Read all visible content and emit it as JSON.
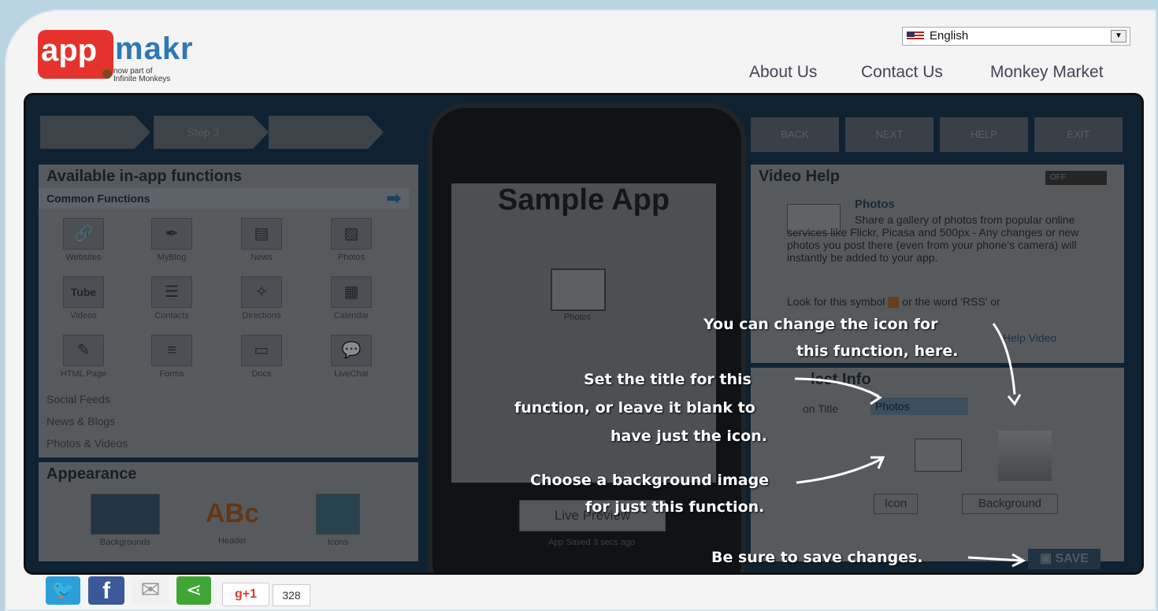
{
  "header": {
    "logo_app": "app",
    "logo_makr": "makr",
    "logo_sub_line1": "now part of",
    "logo_sub_line2": "Infinite Monkeys",
    "language": "English",
    "nav": [
      "About Us",
      "Contact Us",
      "Monkey Market"
    ]
  },
  "steps": [
    "",
    "Step 3",
    ""
  ],
  "nav_buttons": [
    "BACK",
    "NEXT",
    "HELP",
    "EXIT"
  ],
  "functions_panel": {
    "title": "Available in-app functions",
    "common": "Common Functions",
    "items": [
      "Websites",
      "MyBlog",
      "News",
      "Photos",
      "Videos",
      "Contacts",
      "Directions",
      "Calendar",
      "HTML Page",
      "Forms",
      "Docs",
      "LiveChat"
    ],
    "categories": [
      "Social Feeds",
      "News & Blogs",
      "Photos & Videos"
    ]
  },
  "appearance": {
    "title": "Appearance",
    "items": [
      "Backgrounds",
      "Header",
      "Icons"
    ]
  },
  "phone": {
    "app_title": "Sample App",
    "screen_icon_label": "Photos",
    "live_preview": "Live Preview",
    "saved": "App Saved 3 secs ago"
  },
  "video_help": {
    "title": "Video Help",
    "toggle": "OFF",
    "heading": "Photos",
    "text_a": "Share a gallery of photos from popular online services like Flickr, Picasa and 500px - Any changes or new photos you post there (even from your phone's camera) will instantly be added to your app.",
    "text_b": "Look for this symbol",
    "text_c": "or the word 'RSS' or",
    "link": "Help Video"
  },
  "select_info": {
    "title": "lect Info",
    "label": "on Title",
    "value": "Photos",
    "icon_btn": "Icon",
    "bg_btn": "Background",
    "save": "SAVE"
  },
  "annotations": {
    "n1_l1": "You can change the icon for",
    "n1_l2": "this function, here.",
    "n2_l1": "Set the title for this",
    "n2_l2": "function, or leave it blank to",
    "n2_l3": "have just the icon.",
    "n3_l1": "Choose a background image",
    "n3_l2": "for just this function.",
    "n4": "Be sure to save changes."
  },
  "share": {
    "gplus": "g+1",
    "count": "328"
  },
  "colors": {
    "brand_red": "#e5322d",
    "brand_blue": "#2f78b3",
    "app_bg": "#1b3f5c",
    "twitter": "#2a9fd8",
    "facebook": "#3b5998",
    "share_green": "#3fa535"
  }
}
